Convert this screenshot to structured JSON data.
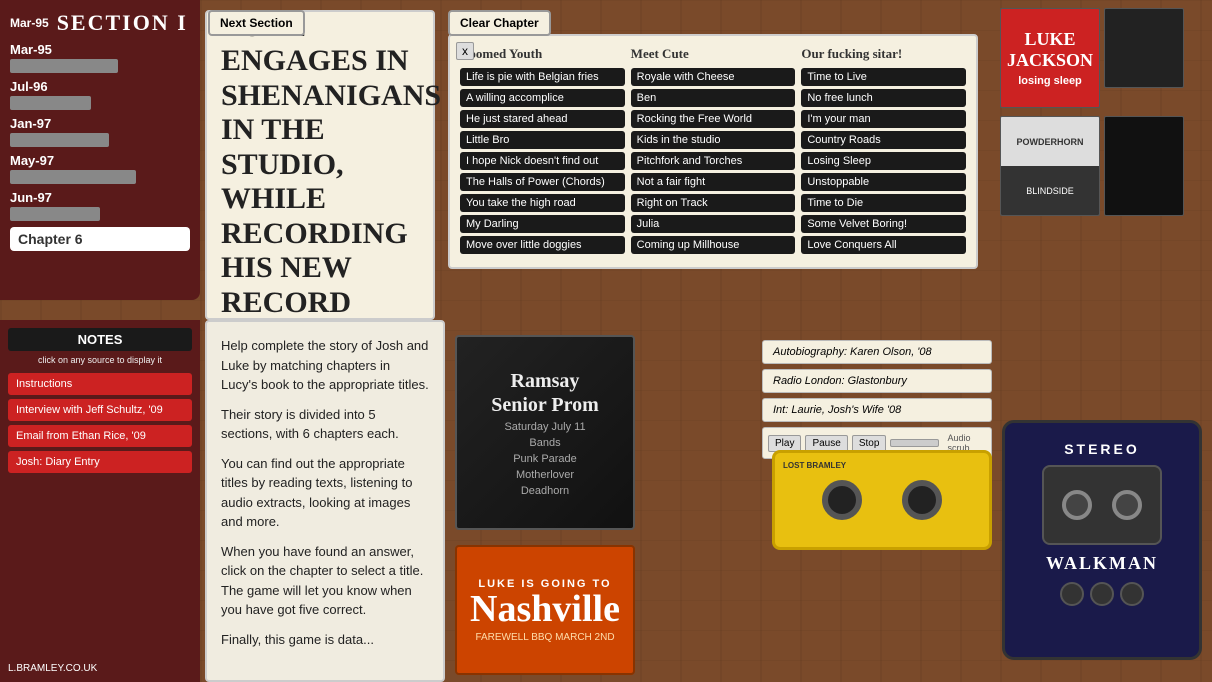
{
  "sidebar": {
    "title": "SECTION I",
    "items": [
      {
        "date": "Mar-95",
        "bar_width": "60"
      },
      {
        "date": "Jul-96",
        "bar_width": "45"
      },
      {
        "date": "Jan-97",
        "bar_width": "55"
      },
      {
        "date": "May-97",
        "bar_width": "70"
      },
      {
        "date": "Jun-97",
        "bar_width": "50"
      }
    ],
    "chapter": "Chapter 6"
  },
  "next_section_label": "Next Section",
  "clear_chapter_label": "Clear Chapter",
  "close_label": "x",
  "big_text": "Luke engages in shenanigans in the studio, while recording his new record",
  "track_list": {
    "columns": [
      {
        "header": "Doomed Youth",
        "tracks": [
          "Life is pie with Belgian fries",
          "A willing accomplice",
          "He just stared ahead",
          "Little Bro",
          "I hope Nick doesn't find out",
          "The Halls of Power (Chords)",
          "You take the high road",
          "My Darling",
          "Move over little doggies"
        ]
      },
      {
        "header": "Meet Cute",
        "tracks": [
          "Royale with Cheese",
          "Ben",
          "Rocking the Free World",
          "Kids in the studio",
          "Pitchfork and Torches",
          "Not a fair fight",
          "Right on Track",
          "Julia",
          "Coming up Millhouse"
        ]
      },
      {
        "header": "Our fucking sitar!",
        "tracks": [
          "Time to Live",
          "No free lunch",
          "I'm your man",
          "Country Roads",
          "Losing Sleep",
          "Unstoppable",
          "Time to Die",
          "Some Velvet Boring!",
          "Love Conquers All"
        ]
      }
    ]
  },
  "albums": {
    "luke_title": "LUKE JACKSON",
    "luke_subtitle": "losing sleep",
    "powder_title": "POWDERHORN",
    "powder_sub": "BLINDSIDE"
  },
  "notes": {
    "title": "NOTES",
    "subtitle": "click on any source to display it",
    "items": [
      "Instructions",
      "Interview with Jeff Schultz, '09",
      "Email from Ethan Rice, '09",
      "Josh: Diary Entry"
    ]
  },
  "help_text": {
    "paragraphs": [
      "Help complete the story of Josh and Luke by matching chapters in Lucy's book to the appropriate titles.",
      "Their story is divided into 5 sections, with 6 chapters each.",
      "You can find out the appropriate titles by reading texts, listening to audio extracts, looking at images and more.",
      "When you have found an answer, click on the chapter to select a title. The game will let you know when you have got five correct.",
      "Finally, this game is data..."
    ]
  },
  "concert": {
    "line1": "Ramsay",
    "line2": "Senior Prom",
    "line3": "Saturday July 11",
    "line4": "Bands",
    "line5": "Punk Parade",
    "line6": "Motherlover",
    "line7": "Deadhorn"
  },
  "nashville": {
    "going_to": "LUKE IS GOING TO",
    "city": "Nashville",
    "sub": "FAREWELL BBQ\nMARCH 2ND"
  },
  "audio": {
    "sources": [
      "Autobiography: Karen Olson, '08",
      "Radio London: Glastonbury",
      "Int: Laurie, Josh's Wife '08"
    ],
    "play": "Play",
    "pause": "Pause",
    "stop": "Stop",
    "scrub_label": "Audio scrub"
  },
  "walkman": {
    "stereo": "STEREO",
    "label": "WALKMAN"
  },
  "footer": {
    "credit": "L.BRAMLEY.CO.UK"
  }
}
